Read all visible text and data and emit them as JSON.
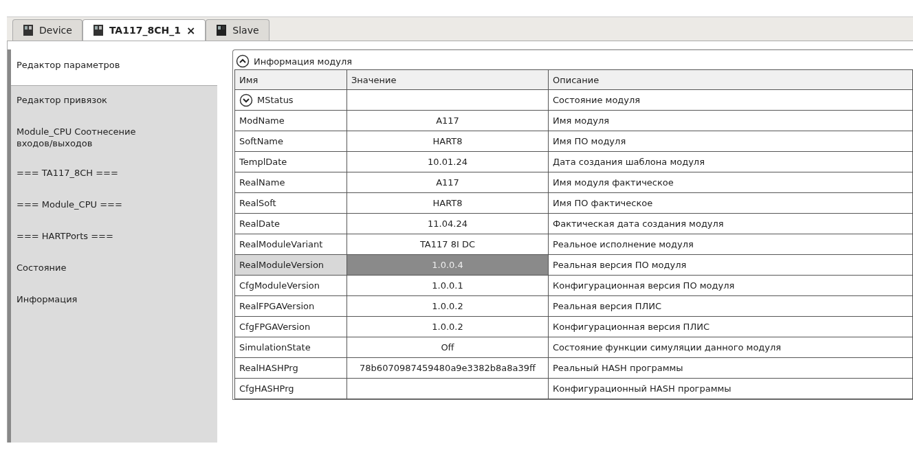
{
  "tabs": [
    {
      "label": "Device",
      "selected": false
    },
    {
      "label": "TA117_8CH_1",
      "selected": true,
      "close": "×"
    },
    {
      "label": "Slave",
      "selected": false
    }
  ],
  "sidebar": {
    "items": [
      {
        "label": "Редактор параметров",
        "selected": true
      },
      {
        "label": "Редактор привязок",
        "selected": false
      },
      {
        "label": "Module_CPU Соотнесение входов/выходов",
        "selected": false
      },
      {
        "label": "=== TA117_8CH ===",
        "selected": false
      },
      {
        "label": "=== Module_CPU ===",
        "selected": false
      },
      {
        "label": "=== HARTPorts ===",
        "selected": false
      },
      {
        "label": "Состояние",
        "selected": false
      },
      {
        "label": "Информация",
        "selected": false
      }
    ]
  },
  "section": {
    "title": "Информация модуля",
    "expanded": true
  },
  "table": {
    "columns": [
      "Имя",
      "Значение",
      "Описание"
    ],
    "rows": [
      {
        "kind": "group",
        "name": "MStatus",
        "value": "",
        "description": "Состояние модуля",
        "selected": false,
        "expanded": false
      },
      {
        "kind": "param",
        "name": "ModName",
        "value": "A117",
        "description": "Имя модуля",
        "selected": false
      },
      {
        "kind": "param",
        "name": "SoftName",
        "value": "HART8",
        "description": "Имя ПО модуля",
        "selected": false
      },
      {
        "kind": "param",
        "name": "TemplDate",
        "value": "10.01.24",
        "description": "Дата создания шаблона модуля",
        "selected": false
      },
      {
        "kind": "param",
        "name": "RealName",
        "value": "A117",
        "description": "Имя модуля фактическое",
        "selected": false
      },
      {
        "kind": "param",
        "name": "RealSoft",
        "value": "HART8",
        "description": "Имя ПО фактическое",
        "selected": false
      },
      {
        "kind": "param",
        "name": "RealDate",
        "value": "11.04.24",
        "description": "Фактическая дата создания модуля",
        "selected": false
      },
      {
        "kind": "param",
        "name": "RealModuleVariant",
        "value": "TA117 8I DC",
        "description": "Реальное исполнение модуля",
        "selected": false
      },
      {
        "kind": "param",
        "name": "RealModuleVersion",
        "value": "1.0.0.4",
        "description": "Реальная версия ПО модуля",
        "selected": true
      },
      {
        "kind": "param",
        "name": "CfgModuleVersion",
        "value": "1.0.0.1",
        "description": "Конфигурационная версия ПО модуля",
        "selected": false
      },
      {
        "kind": "param",
        "name": "RealFPGAVersion",
        "value": "1.0.0.2",
        "description": "Реальная версия ПЛИС",
        "selected": false
      },
      {
        "kind": "param",
        "name": "CfgFPGAVersion",
        "value": "1.0.0.2",
        "description": "Конфигурационная версия ПЛИС",
        "selected": false
      },
      {
        "kind": "param",
        "name": "SimulationState",
        "value": "Off",
        "description": "Состояние функции симуляции данного модуля",
        "selected": false
      },
      {
        "kind": "param",
        "name": "RealHASHPrg",
        "value": "78b6070987459480a9e3382b8a8a39ff",
        "description": "Реальный HASH программы",
        "selected": false
      },
      {
        "kind": "param",
        "name": "CfgHASHPrg",
        "value": "",
        "description": "Конфигурационный HASH программы",
        "selected": false
      }
    ]
  }
}
